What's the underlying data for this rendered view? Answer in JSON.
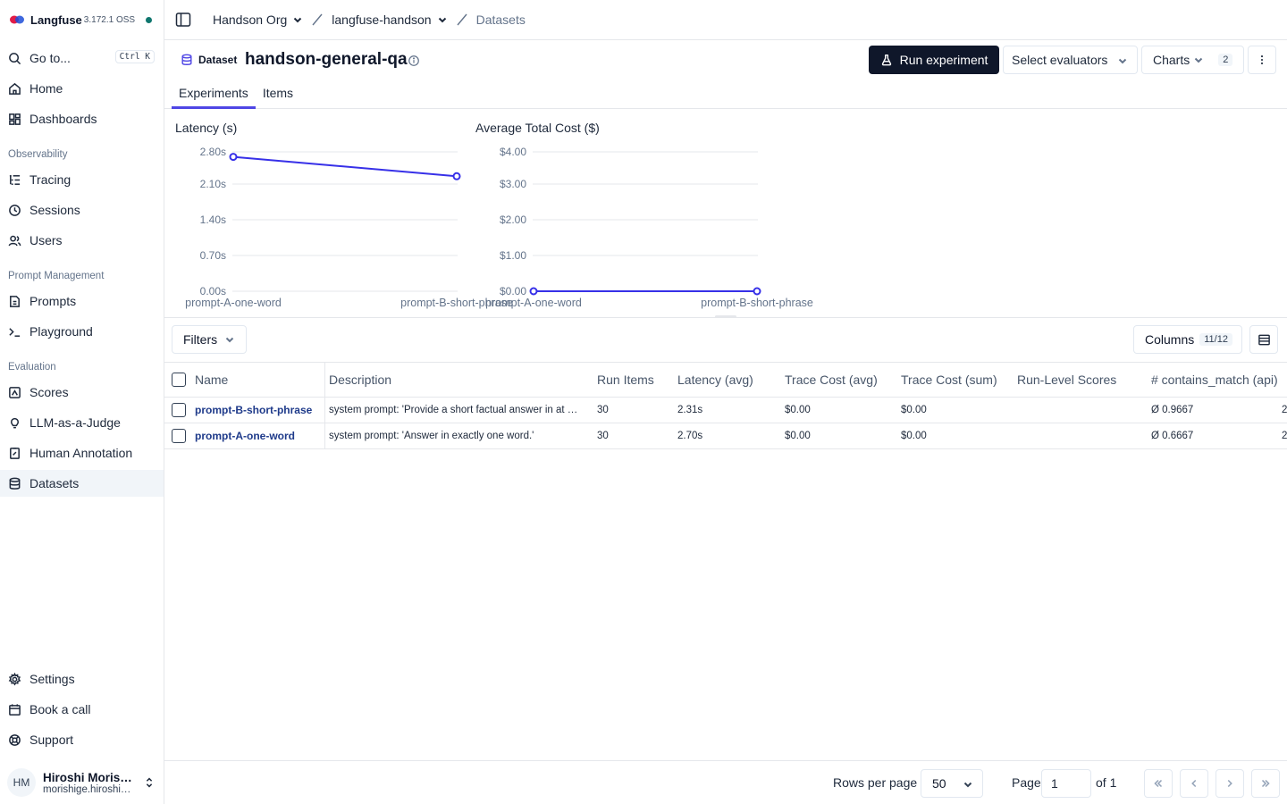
{
  "brand": {
    "name": "Langfuse",
    "version": "3.172.1 OSS"
  },
  "sidebar": {
    "goto": {
      "label": "Go to...",
      "shortcut": "Ctrl K"
    },
    "top_items": [
      {
        "label": "Home",
        "icon": "home-icon"
      },
      {
        "label": "Dashboards",
        "icon": "dashboard-icon"
      }
    ],
    "groups": [
      {
        "title": "Observability",
        "items": [
          "Tracing",
          "Sessions",
          "Users"
        ]
      },
      {
        "title": "Prompt Management",
        "items": [
          "Prompts",
          "Playground"
        ]
      },
      {
        "title": "Evaluation",
        "items": [
          "Scores",
          "LLM-as-a-Judge",
          "Human Annotation",
          "Datasets"
        ]
      }
    ],
    "bottom_items": [
      "Settings",
      "Book a call",
      "Support"
    ],
    "active_item": "Datasets",
    "user": {
      "initials": "HM",
      "name": "Hiroshi Moris…",
      "email": "morishige.hiroshi…"
    }
  },
  "breadcrumb": {
    "org": "Handson Org",
    "project": "langfuse-handson",
    "page": "Datasets"
  },
  "header": {
    "dataset_label": "Dataset",
    "title": "handson-general-qa",
    "run_button": "Run experiment",
    "evaluators_select": "Select evaluators",
    "charts_button": "Charts",
    "charts_count": "2",
    "tabs": [
      "Experiments",
      "Items"
    ],
    "active_tab": "Experiments"
  },
  "chart_data": [
    {
      "type": "line",
      "title": "Latency (s)",
      "categories": [
        "prompt-A-one-word",
        "prompt-B-short-phrase"
      ],
      "values": [
        2.7,
        2.31
      ],
      "yticks": [
        "0.00s",
        "0.70s",
        "1.40s",
        "2.10s",
        "2.80s"
      ],
      "ylim": [
        0,
        2.8
      ],
      "color": "#3730e8"
    },
    {
      "type": "line",
      "title": "Average Total Cost ($)",
      "categories": [
        "prompt-A-one-word",
        "prompt-B-short-phrase"
      ],
      "values": [
        0.0,
        0.0
      ],
      "yticks": [
        "$0.00",
        "$1.00",
        "$2.00",
        "$3.00",
        "$4.00"
      ],
      "ylim": [
        0,
        4
      ],
      "color": "#3730e8"
    }
  ],
  "toolbar": {
    "filters": "Filters",
    "columns": "Columns",
    "columns_count": "11/12"
  },
  "table": {
    "headers": [
      "Name",
      "Description",
      "Run Items",
      "Latency (avg)",
      "Trace Cost (avg)",
      "Trace Cost (sum)",
      "Run-Level Scores",
      "# contains_match (api)"
    ],
    "rows": [
      {
        "name": "prompt-B-short-phrase",
        "description": "system prompt: 'Provide a short factual answer in at …",
        "run_items": "30",
        "latency": "2.31s",
        "cost_avg": "$0.00",
        "cost_sum": "$0.00",
        "run_scores": "",
        "contains_match": "Ø 0.9667",
        "extra": "2"
      },
      {
        "name": "prompt-A-one-word",
        "description": "system prompt: 'Answer in exactly one word.'",
        "run_items": "30",
        "latency": "2.70s",
        "cost_avg": "$0.00",
        "cost_sum": "$0.00",
        "run_scores": "",
        "contains_match": "Ø 0.6667",
        "extra": "2"
      }
    ]
  },
  "footer": {
    "rows_per_page_label": "Rows per page",
    "rows_per_page": "50",
    "page_label": "Page",
    "page": "1",
    "of_label": "of 1"
  }
}
